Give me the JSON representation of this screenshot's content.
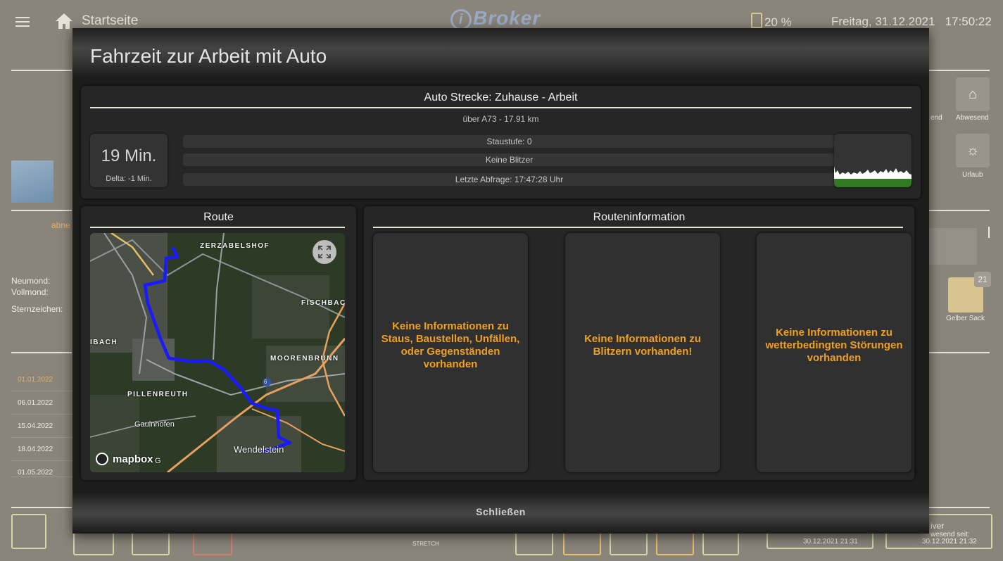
{
  "topbar": {
    "title": "Startseite",
    "logo": "Broker",
    "logo_letter": "i",
    "battery": "20 %",
    "datetime": "Freitag, 31.12.2021   17:50:22"
  },
  "background": {
    "labels": {
      "abnehmend": "abne",
      "neumond": "Neumond:",
      "vollmond": "Vollmond:",
      "sternzeichen": "Sternzeichen:"
    },
    "dates": [
      "01.01.2022",
      "06.01.2022",
      "15.04.2022",
      "18.04.2022",
      "01.05.2022"
    ],
    "right_icons": {
      "abwesend": "Abwesend",
      "abwesend_left": "end",
      "urlaub": "Urlaub",
      "gelber_sack": "Gelber Sack",
      "badge": "21"
    },
    "bottom": {
      "status1": "30.12.2021 21:31",
      "status2_title": "iver",
      "status2_label": "wesend seit:",
      "status2_time": "30.12.2021 21:32",
      "brand": "STRETCH"
    }
  },
  "modal": {
    "title": "Fahrzeit zur Arbeit mit Auto",
    "close_label": "Schließen",
    "strecke": {
      "title": "Auto Strecke: Zuhause - Arbeit",
      "subtitle": "über A73 - 17.91 km",
      "time": "19 Min.",
      "delta": "Delta: -1 Min.",
      "staustufe": "Staustufe: 0",
      "blitzer": "Keine Blitzer",
      "abfrage": "Letzte Abfrage: 17:47:28 Uhr"
    },
    "route": {
      "title": "Route",
      "map_labels": {
        "zerzabelshof": "ZERZABELSHOF",
        "fischbach": "FISCHBAC",
        "moorenbrunn": "MOORENBRUNN",
        "ibach": "IBACH",
        "pillenreuth": "PILLENREUTH",
        "gaulnhofen": "Gaulnhofen",
        "wendelstein": "Wendelstein",
        "shield": "6",
        "attribution": "G"
      },
      "mapbox": "mapbox"
    },
    "info": {
      "title": "Routeninformation",
      "cards": [
        "Keine Informationen zu Staus, Baustellen, Unfällen, oder Gegenständen vorhanden",
        "Keine Informationen zu Blitzern vorhanden!",
        "Keine Informationen zu wetterbedingten Störungen vorhanden"
      ]
    }
  },
  "colors": {
    "warning": "#f0a020",
    "route": "#1a1aff",
    "modal_bg": "#1c1c1c"
  }
}
